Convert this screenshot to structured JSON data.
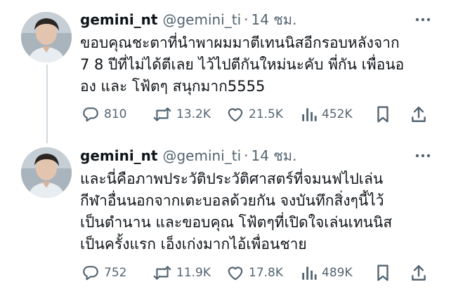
{
  "tweets": [
    {
      "display_name": "gemini_nt",
      "handle": "@gemini_ti",
      "separator": "·",
      "time": "14 ชม.",
      "text": "ขอบคุณชะตาที่นำพาผมมาตีเทนนิสอีกรอบหลังจาก\n7 8 ปีที่ไม่ได้ตีเลย ไว้ไปตีกันใหม่นะคับ พี่กัน เพื่อนอ\nอง และ โฟ้ตๆ สนุกมาก5555",
      "replies": "810",
      "reposts": "13.2K",
      "likes": "21.5K",
      "views": "452K"
    },
    {
      "display_name": "gemini_nt",
      "handle": "@gemini_ti",
      "separator": "·",
      "time": "14 ชม.",
      "text": "และนี่คือภาพประวัติประวัติศาสตร์ที่จมนฟไปเล่น\nกีฬาอื่นนอกจากเตะบอลด้วยกัน จงบันทึกสิ่งๆนี้ไว้\nเป็นตำนาน และขอบคุณ โฟ้ตๆที่เปิดใจเล่นเทนนิส\nเป็นครั้งแรก เอ็งเก่งมากไอ้เพื่อนชาย",
      "replies": "752",
      "reposts": "11.9K",
      "likes": "17.8K",
      "views": "489K"
    }
  ],
  "icons": {
    "reply": "speech-bubble-icon",
    "repost": "repost-arrows-icon",
    "like": "heart-icon",
    "views": "bar-chart-icon",
    "bookmark": "bookmark-icon",
    "share": "share-upload-icon",
    "more": "more-dots-icon"
  },
  "colors": {
    "text": "#0f1419",
    "secondary": "#536471",
    "thread_line": "#cfd9de"
  }
}
